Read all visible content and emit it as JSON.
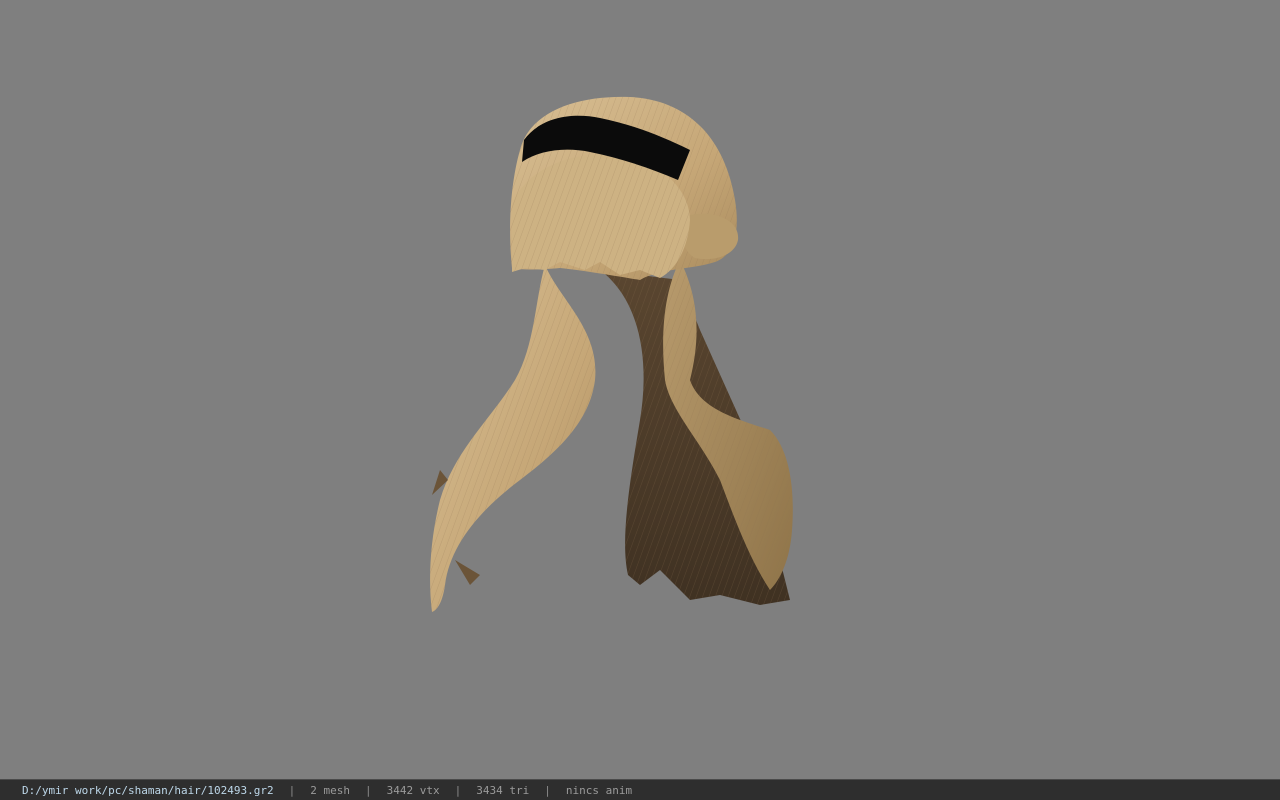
{
  "viewer": {
    "background_color": "#7f7f7f",
    "model_icon": "hair-model",
    "hair_color": "#c9ab7c",
    "hair_shadow_color": "#4e3d29",
    "band_color": "#0b0b0b"
  },
  "status": {
    "file_path": "D:/ymir work/pc/shaman/hair/102493.gr2",
    "separator": "|",
    "mesh_count": "2 mesh",
    "vertex_count": "3442 vtx",
    "triangle_count": "3434 tri",
    "animation": "nincs anim"
  }
}
